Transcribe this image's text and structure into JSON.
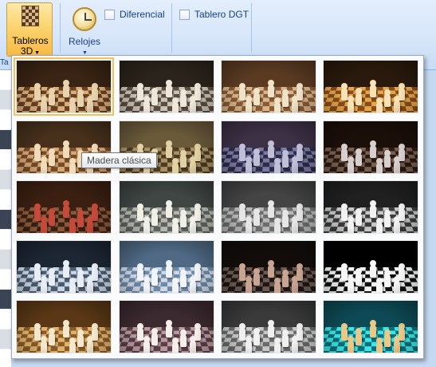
{
  "ribbon": {
    "tableros_button": {
      "label_line1": "Tableros",
      "label_line2": "3D",
      "icon": "chessboard-3d-icon"
    },
    "relojes_button": {
      "label": "Relojes",
      "icon": "clock-icon"
    },
    "diferencial": {
      "label": "Diferencial",
      "checked": false
    },
    "tablero_dgt": {
      "label": "Tablero DGT",
      "checked": false
    },
    "group_label_fragment": "Ta"
  },
  "gallery": {
    "selected_index": 0,
    "hover_index": 4,
    "tooltip": "Madera clásica",
    "thumbnails": [
      {
        "light": "#d8b07a",
        "dark": "#6b3f22",
        "bg": "#3a2414",
        "piece": "#e9d3ae"
      },
      {
        "light": "#c9c4b6",
        "dark": "#5b4c3e",
        "bg": "#2b241c",
        "piece": "#efe8da"
      },
      {
        "light": "#d6b68c",
        "dark": "#8a5a36",
        "bg": "#5a3b22",
        "piece": "#f1e3c8"
      },
      {
        "light": "#e2a84a",
        "dark": "#8a4b1c",
        "bg": "#2a1a0d",
        "piece": "#f7e1b5"
      },
      {
        "light": "#d4aa78",
        "dark": "#7b4a28",
        "bg": "#47301c",
        "piece": "#f0dcb8"
      },
      {
        "light": "#a89164",
        "dark": "#4e3b22",
        "bg": "#6a5a3a",
        "piece": "#e2d1a4"
      },
      {
        "light": "#7b7aa4",
        "dark": "#2d2c47",
        "bg": "#3d3146",
        "piece": "#bfc0d8"
      },
      {
        "light": "#7a6050",
        "dark": "#2a1a12",
        "bg": "#1b0f0a",
        "piece": "#d7d0cf"
      },
      {
        "light": "#8b5a3a",
        "dark": "#3b2014",
        "bg": "#3b2012",
        "piece": "#c64a3a"
      },
      {
        "light": "#b7b7b0",
        "dark": "#5d635e",
        "bg": "#3f4643",
        "piece": "#f1f0e8"
      },
      {
        "light": "#b8b8b8",
        "dark": "#6d6d6d",
        "bg": "#444444",
        "piece": "#e6e6e6"
      },
      {
        "light": "#c7c7c7",
        "dark": "#3c3c3c",
        "bg": "#202020",
        "piece": "#f2f2f2"
      },
      {
        "light": "#c9d6e4",
        "dark": "#4c5c70",
        "bg": "#1d2633",
        "piece": "#e8eef6"
      },
      {
        "light": "#cfd9e6",
        "dark": "#6d8aa8",
        "bg": "#506a86",
        "piece": "#f1f5fa"
      },
      {
        "light": "#6b5b53",
        "dark": "#1f1613",
        "bg": "#120d0b",
        "piece": "#c9a493"
      },
      {
        "light": "#f2f2f2",
        "dark": "#111111",
        "bg": "#000000",
        "piece": "#f6f6f6"
      },
      {
        "light": "#e0b46a",
        "dark": "#8a5a2c",
        "bg": "#5a3816",
        "piece": "#f3e7cc"
      },
      {
        "light": "#b79aa2",
        "dark": "#5b3e46",
        "bg": "#3b2a2f",
        "piece": "#f4efe9"
      },
      {
        "light": "#c8c8c8",
        "dark": "#6a6a6a",
        "bg": "#3a3a3a",
        "piece": "#f0f0f0"
      },
      {
        "light": "#3fe6e6",
        "dark": "#0c6f7a",
        "bg": "#0e4a55",
        "piece": "#e8c98a"
      }
    ]
  }
}
